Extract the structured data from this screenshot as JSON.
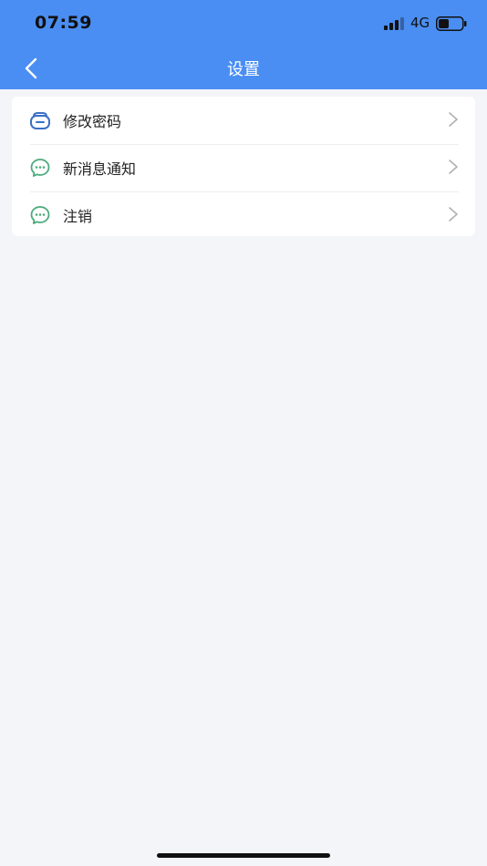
{
  "status_bar": {
    "time": "07:59",
    "network": "4G",
    "battery_level": 0.45
  },
  "nav": {
    "title": "设置",
    "back_icon": "chevron-left-icon"
  },
  "settings": {
    "items": [
      {
        "label": "修改密码",
        "icon": "password-icon",
        "icon_color": "#3b6fc4"
      },
      {
        "label": "新消息通知",
        "icon": "chat-bubble-icon",
        "icon_color": "#4caa7c"
      },
      {
        "label": "注销",
        "icon": "chat-bubble-icon",
        "icon_color": "#4caa7c"
      }
    ]
  },
  "colors": {
    "header": "#4a8ef3",
    "background": "#f4f5f9",
    "card": "#ffffff",
    "chevron": "#b0b0b0"
  }
}
